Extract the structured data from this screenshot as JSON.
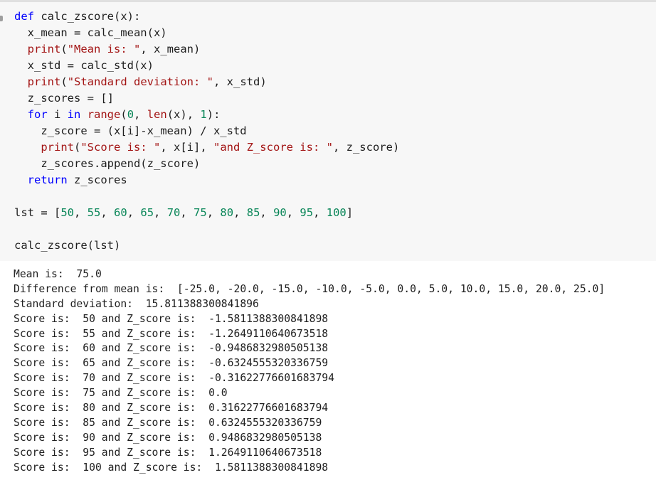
{
  "code": {
    "lines": [
      [
        {
          "t": "def",
          "c": "kw"
        },
        {
          "t": " calc_zscore(x):"
        }
      ],
      [
        {
          "t": "  x_mean = calc_mean(x)"
        }
      ],
      [
        {
          "t": "  "
        },
        {
          "t": "print",
          "c": "str"
        },
        {
          "t": "("
        },
        {
          "t": "\"Mean is: \"",
          "c": "str"
        },
        {
          "t": ", x_mean)"
        }
      ],
      [
        {
          "t": "  x_std = calc_std(x)"
        }
      ],
      [
        {
          "t": "  "
        },
        {
          "t": "print",
          "c": "str"
        },
        {
          "t": "("
        },
        {
          "t": "\"Standard deviation: \"",
          "c": "str"
        },
        {
          "t": ", x_std)"
        }
      ],
      [
        {
          "t": "  z_scores = []"
        }
      ],
      [
        {
          "t": "  "
        },
        {
          "t": "for",
          "c": "kw"
        },
        {
          "t": " i "
        },
        {
          "t": "in",
          "c": "kw"
        },
        {
          "t": " "
        },
        {
          "t": "range",
          "c": "str"
        },
        {
          "t": "("
        },
        {
          "t": "0",
          "c": "num"
        },
        {
          "t": ", "
        },
        {
          "t": "len",
          "c": "str"
        },
        {
          "t": "(x), "
        },
        {
          "t": "1",
          "c": "num"
        },
        {
          "t": "):"
        }
      ],
      [
        {
          "t": "    z_score = (x[i]-x_mean) / x_std"
        }
      ],
      [
        {
          "t": "    "
        },
        {
          "t": "print",
          "c": "str"
        },
        {
          "t": "("
        },
        {
          "t": "\"Score is: \"",
          "c": "str"
        },
        {
          "t": ", x[i], "
        },
        {
          "t": "\"and Z_score is: \"",
          "c": "str"
        },
        {
          "t": ", z_score)"
        }
      ],
      [
        {
          "t": "    z_scores.append(z_score)"
        }
      ],
      [
        {
          "t": "  "
        },
        {
          "t": "return",
          "c": "kw"
        },
        {
          "t": " z_scores"
        }
      ],
      [],
      [
        {
          "t": "lst = ["
        },
        {
          "t": "50",
          "c": "num"
        },
        {
          "t": ", "
        },
        {
          "t": "55",
          "c": "num"
        },
        {
          "t": ", "
        },
        {
          "t": "60",
          "c": "num"
        },
        {
          "t": ", "
        },
        {
          "t": "65",
          "c": "num"
        },
        {
          "t": ", "
        },
        {
          "t": "70",
          "c": "num"
        },
        {
          "t": ", "
        },
        {
          "t": "75",
          "c": "num"
        },
        {
          "t": ", "
        },
        {
          "t": "80",
          "c": "num"
        },
        {
          "t": ", "
        },
        {
          "t": "85",
          "c": "num"
        },
        {
          "t": ", "
        },
        {
          "t": "90",
          "c": "num"
        },
        {
          "t": ", "
        },
        {
          "t": "95",
          "c": "num"
        },
        {
          "t": ", "
        },
        {
          "t": "100",
          "c": "num"
        },
        {
          "t": "]"
        }
      ],
      [],
      [
        {
          "t": "calc_zscore(lst)"
        }
      ]
    ]
  },
  "output": {
    "lines": [
      "Mean is:  75.0",
      "Difference from mean is:  [-25.0, -20.0, -15.0, -10.0, -5.0, 0.0, 5.0, 10.0, 15.0, 20.0, 25.0]",
      "Standard deviation:  15.811388300841896",
      "Score is:  50 and Z_score is:  -1.5811388300841898",
      "Score is:  55 and Z_score is:  -1.2649110640673518",
      "Score is:  60 and Z_score is:  -0.9486832980505138",
      "Score is:  65 and Z_score is:  -0.6324555320336759",
      "Score is:  70 and Z_score is:  -0.31622776601683794",
      "Score is:  75 and Z_score is:  0.0",
      "Score is:  80 and Z_score is:  0.31622776601683794",
      "Score is:  85 and Z_score is:  0.6324555320336759",
      "Score is:  90 and Z_score is:  0.9486832980505138",
      "Score is:  95 and Z_score is:  1.2649110640673518",
      "Score is:  100 and Z_score is:  1.5811388300841898"
    ]
  }
}
